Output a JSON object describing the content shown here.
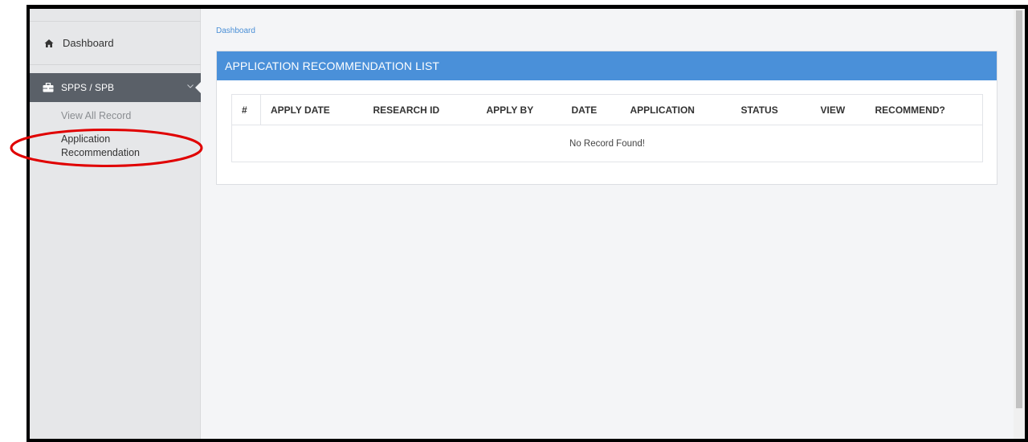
{
  "sidebar": {
    "dashboard_label": "Dashboard",
    "section_label": "SPPS / SPB",
    "sub_items": [
      "View All Record",
      "Application Recommendation"
    ]
  },
  "breadcrumb": "Dashboard",
  "panel": {
    "title": "APPLICATION RECOMMENDATION LIST",
    "columns": [
      "#",
      "APPLY DATE",
      "RESEARCH ID",
      "APPLY BY",
      "DATE",
      "APPLICATION",
      "STATUS",
      "VIEW",
      "RECOMMEND?"
    ],
    "empty_text": "No Record Found!"
  },
  "colors": {
    "header_blue": "#4a90d9",
    "active_nav": "#5a6068",
    "annotation_red": "#e00000"
  }
}
